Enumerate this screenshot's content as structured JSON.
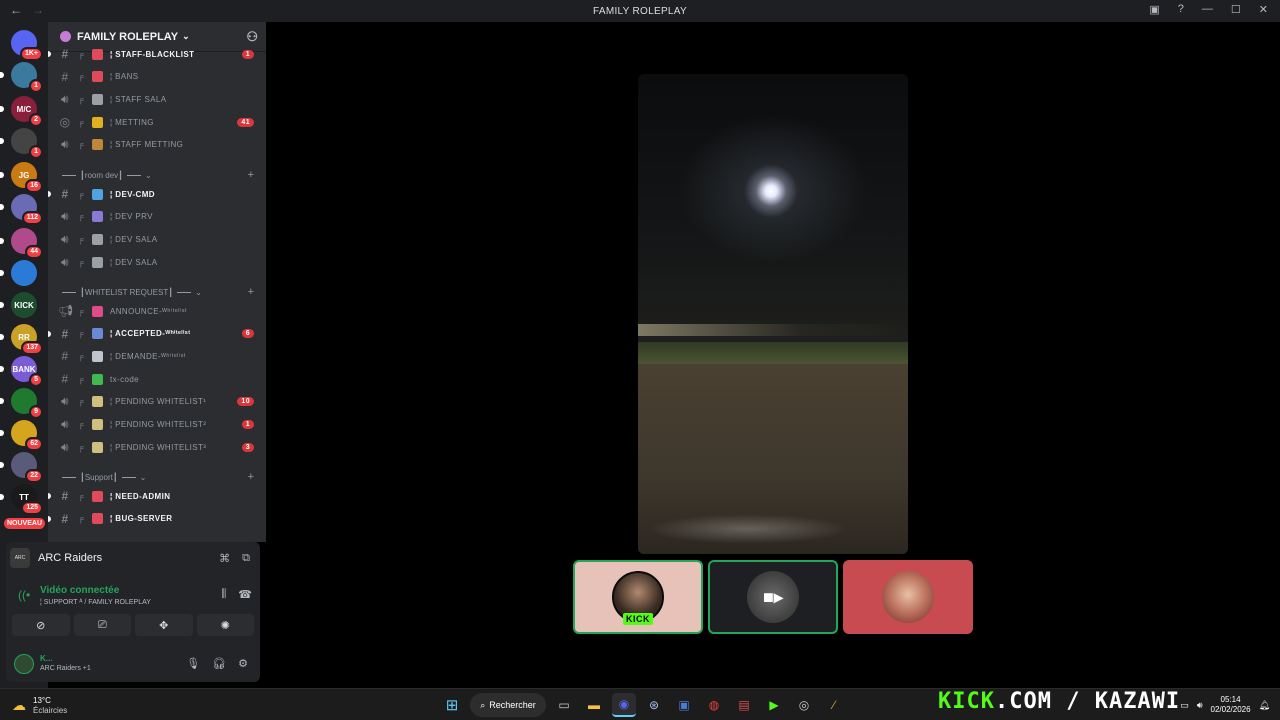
{
  "window": {
    "title": "FAMILY ROLEPLAY"
  },
  "rail": {
    "nouveau_label": "NOUVEAU",
    "servers": [
      {
        "name": "discord-home",
        "badge": "1K+",
        "color": "#5865f2",
        "icon": "discord-icon"
      },
      {
        "name": "server-1",
        "badge": "1",
        "color": "#3b7a9e"
      },
      {
        "name": "server-2",
        "badge": "2",
        "color": "#8a1f3b",
        "text": "M/C"
      },
      {
        "name": "server-3",
        "badge": "1",
        "color": "#444"
      },
      {
        "name": "server-4",
        "badge": "16",
        "color": "#c97b12",
        "text": "JG"
      },
      {
        "name": "server-5",
        "badge": "112",
        "color": "#6b6bb5"
      },
      {
        "name": "server-6",
        "badge": "44",
        "color": "#b04a8a"
      },
      {
        "name": "server-7",
        "badge": "",
        "color": "#2b7bd6"
      },
      {
        "name": "server-8",
        "badge": "",
        "color": "#1d4d2d",
        "text": "KICK"
      },
      {
        "name": "server-9",
        "badge": "137",
        "color": "#c9a227",
        "text": "RR"
      },
      {
        "name": "server-10",
        "badge": "5",
        "color": "#7a5cd6",
        "text": "BANK"
      },
      {
        "name": "server-11",
        "badge": "9",
        "color": "#1f7a2f"
      },
      {
        "name": "server-12",
        "badge": "62",
        "color": "#d6a51f"
      },
      {
        "name": "server-13",
        "badge": "22",
        "color": "#5a5a7a"
      },
      {
        "name": "server-14",
        "badge": "125",
        "color": "#1a1a1a",
        "text": "TT"
      }
    ]
  },
  "sidebar": {
    "guild_name": "FAMILY ROLEPLAY",
    "channels": [
      {
        "type": "text",
        "emoji_color": "#e04b5b",
        "name": "¦ STAFF-BLACKLIST",
        "bold": true,
        "count": "1"
      },
      {
        "type": "text",
        "emoji_color": "#e04b5b",
        "name": "¦ BANS",
        "bold": false,
        "count": ""
      },
      {
        "type": "voice",
        "emoji_color": "#9aa0a6",
        "name": "¦ STAFF SALA",
        "bold": false,
        "count": ""
      },
      {
        "type": "stage",
        "emoji_color": "#e0b020",
        "name": "¦ METTING",
        "bold": false,
        "count": "41"
      },
      {
        "type": "voice",
        "emoji_color": "#c0873a",
        "name": "¦ STAFF METTING",
        "bold": false,
        "count": ""
      }
    ],
    "cat_room_dev": "┃room dev┃",
    "dev_channels": [
      {
        "type": "text",
        "emoji_color": "#4fa3e0",
        "name": "¦ DEV-CMD",
        "bold": true,
        "count": ""
      },
      {
        "type": "voice",
        "emoji_color": "#8a7ad6",
        "name": "¦ DEV PRV",
        "bold": false,
        "count": ""
      },
      {
        "type": "voice",
        "emoji_color": "#9aa0a6",
        "name": "¦ DEV SALA",
        "bold": false,
        "count": ""
      },
      {
        "type": "voice",
        "emoji_color": "#9aa0a6",
        "name": "¦ DEV SALA",
        "bold": false,
        "count": ""
      }
    ],
    "cat_whitelist": "┃WHITELIST REQUEST┃",
    "whitelist_channels": [
      {
        "type": "announce",
        "emoji_color": "#e04b8a",
        "name": "ANNOUNCE-ᵂʰⁱᵗᵉˡⁱˢᵗ",
        "bold": false,
        "count": ""
      },
      {
        "type": "text",
        "emoji_color": "#6b8ad6",
        "name": "¦ ACCEPTED-ᵂʰⁱᵗᵉˡⁱˢᵗ",
        "bold": true,
        "count": "6"
      },
      {
        "type": "text",
        "emoji_color": "#c0c4cc",
        "name": "¦ DEMANDE-ᵂʰⁱᵗᵉˡⁱˢᵗ",
        "bold": false,
        "count": ""
      },
      {
        "type": "text",
        "emoji_color": "#3fb950",
        "name": "tx-code",
        "bold": false,
        "count": ""
      },
      {
        "type": "voice",
        "emoji_color": "#d0c080",
        "name": "¦ PENDING WHITELIST¹",
        "bold": false,
        "count": "10"
      },
      {
        "type": "voice",
        "emoji_color": "#d0c080",
        "name": "¦ PENDING WHITELIST²",
        "bold": false,
        "count": "1"
      },
      {
        "type": "voice",
        "emoji_color": "#d0c080",
        "name": "¦ PENDING WHITELIST³",
        "bold": false,
        "count": "3"
      }
    ],
    "cat_support": "┃Support┃",
    "support_channels": [
      {
        "type": "text",
        "emoji_color": "#e04b5b",
        "name": "¦ NEED-ADMIN",
        "bold": true,
        "count": ""
      },
      {
        "type": "text",
        "emoji_color": "#e04b5b",
        "name": "¦ BUG-SERVER",
        "bold": true,
        "count": ""
      }
    ]
  },
  "voice_panel": {
    "activity_name": "ARC Raiders",
    "status": "Vidéo connectée",
    "location": "¦ SUPPORT ᴬ / FAMILY ROLEPLAY",
    "user_name": "K...",
    "user_status": "ARC Raiders +1"
  },
  "stage": {
    "tile1_badge": "KICK"
  },
  "taskbar": {
    "temp": "13°C",
    "weather_desc": "Éclaircies",
    "search_label": "Rechercher",
    "brand_kick": "KICK",
    "brand_rest": ".COM / KAZAWI",
    "time": "05:14",
    "date": "02/02/2026"
  }
}
